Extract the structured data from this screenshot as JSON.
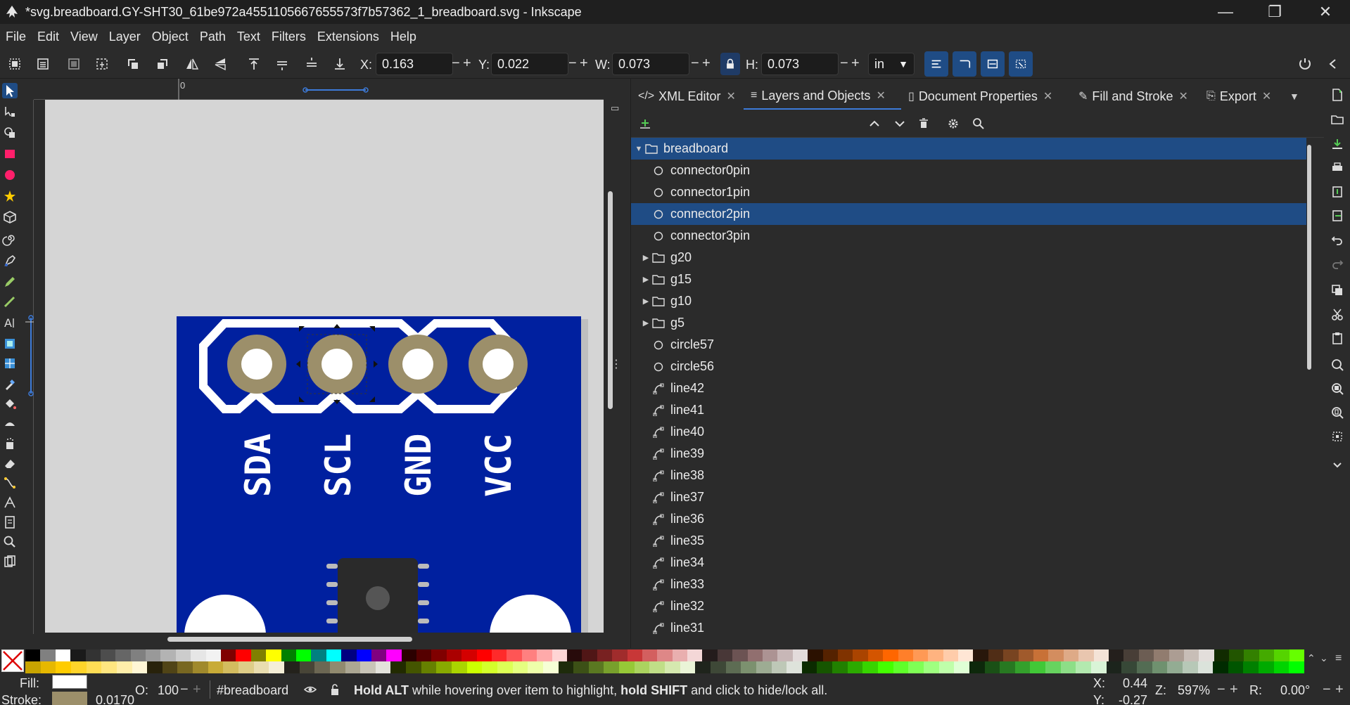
{
  "window": {
    "title": "*svg.breadboard.GY-SHT30_61be972a4551105667655573f7b57362_1_breadboard.svg - Inkscape",
    "minimize": "—",
    "maximize": "❐",
    "close": "✕"
  },
  "menu": [
    "File",
    "Edit",
    "View",
    "Layer",
    "Object",
    "Path",
    "Text",
    "Filters",
    "Extensions",
    "Help"
  ],
  "toolbar": {
    "x_label": "X:",
    "x_value": "0.163",
    "y_label": "Y:",
    "y_value": "0.022",
    "w_label": "W:",
    "w_value": "0.073",
    "h_label": "H:",
    "h_value": "0.073",
    "minus": "−",
    "plus": "+",
    "unit": "in"
  },
  "ruler": {
    "origin_label": "0"
  },
  "board": {
    "pin_labels": [
      "SDA",
      "SCL",
      "GND",
      "VCC"
    ],
    "colors": {
      "board": "#00209f",
      "pad": "#9c8f6a",
      "silk": "#ffffff",
      "chip": "#2a2a2a"
    }
  },
  "dock": {
    "tabs": [
      {
        "label": "XML Editor",
        "icon": "xml-icon"
      },
      {
        "label": "Layers and Objects",
        "icon": "layers-icon"
      },
      {
        "label": "Document Properties",
        "icon": "document-icon"
      },
      {
        "label": "Fill and Stroke",
        "icon": "fill-stroke-icon"
      },
      {
        "label": "Export",
        "icon": "export-icon"
      }
    ],
    "tree": [
      {
        "label": "breadboard",
        "type": "group",
        "depth": 0,
        "expanded": true,
        "selected": true
      },
      {
        "label": "connector0pin",
        "type": "circle",
        "depth": 1
      },
      {
        "label": "connector1pin",
        "type": "circle",
        "depth": 1
      },
      {
        "label": "connector2pin",
        "type": "circle",
        "depth": 1,
        "selected": true
      },
      {
        "label": "connector3pin",
        "type": "circle",
        "depth": 1
      },
      {
        "label": "g20",
        "type": "group",
        "depth": 1,
        "collapsed": true
      },
      {
        "label": "g15",
        "type": "group",
        "depth": 1,
        "collapsed": true
      },
      {
        "label": "g10",
        "type": "group",
        "depth": 1,
        "collapsed": true
      },
      {
        "label": "g5",
        "type": "group",
        "depth": 1,
        "collapsed": true
      },
      {
        "label": "circle57",
        "type": "circle",
        "depth": 1
      },
      {
        "label": "circle56",
        "type": "circle",
        "depth": 1
      },
      {
        "label": "line42",
        "type": "line",
        "depth": 1
      },
      {
        "label": "line41",
        "type": "line",
        "depth": 1
      },
      {
        "label": "line40",
        "type": "line",
        "depth": 1
      },
      {
        "label": "line39",
        "type": "line",
        "depth": 1
      },
      {
        "label": "line38",
        "type": "line",
        "depth": 1
      },
      {
        "label": "line37",
        "type": "line",
        "depth": 1
      },
      {
        "label": "line36",
        "type": "line",
        "depth": 1
      },
      {
        "label": "line35",
        "type": "line",
        "depth": 1
      },
      {
        "label": "line34",
        "type": "line",
        "depth": 1
      },
      {
        "label": "line33",
        "type": "line",
        "depth": 1
      },
      {
        "label": "line32",
        "type": "line",
        "depth": 1
      },
      {
        "label": "line31",
        "type": "line",
        "depth": 1
      }
    ]
  },
  "status": {
    "fill_label": "Fill:",
    "stroke_label": "Stroke:",
    "stroke_width": "0.0170",
    "fill_color": "#ffffff",
    "stroke_color": "#9c8f6a",
    "opacity_label": "O:",
    "opacity_value": "100",
    "layer": "#breadboard",
    "message_bold1": "Hold ALT",
    "message_mid": " while hovering over item to highlight, ",
    "message_bold2": "hold SHIFT",
    "message_end": " and click to hide/lock all.",
    "cursor_x_label": "X:",
    "cursor_x": "0.44",
    "cursor_y_label": "Y:",
    "cursor_y": "-0.27",
    "zoom_label": "Z:",
    "zoom_value": "597%",
    "rotation_label": "R:",
    "rotation_value": "0.00°"
  },
  "palette": {
    "row1": [
      "#000000",
      "#808080",
      "#ffffff",
      "#1a1a1a",
      "#333333",
      "#4d4d4d",
      "#666666",
      "#808080",
      "#999999",
      "#b3b3b3",
      "#cccccc",
      "#e6e6e6",
      "#f2f2f2",
      "#800000",
      "#ff0000",
      "#808000",
      "#ffff00",
      "#008000",
      "#00ff00",
      "#008080",
      "#00ffff",
      "#000080",
      "#0000ff",
      "#800080",
      "#ff00ff",
      "#2b0000",
      "#550000",
      "#800000",
      "#aa0000",
      "#d40000",
      "#ff0000",
      "#ff2a2a",
      "#ff5555",
      "#ff8080",
      "#ffaaaa",
      "#ffd5d5",
      "#280b0b",
      "#501616",
      "#782121",
      "#a02c2c",
      "#c83737",
      "#d35f5f",
      "#de8787",
      "#e9afaf",
      "#f4d7d7",
      "#241c1c",
      "#483737",
      "#6c5353",
      "#916f6f",
      "#ac9393",
      "#c8b7b7",
      "#e3dbdb",
      "#2b1100",
      "#552200",
      "#803300",
      "#aa4400",
      "#d45500",
      "#ff6600",
      "#ff7f2a",
      "#ff9955",
      "#ffb380",
      "#ffccaa",
      "#ffe6d5",
      "#28170b",
      "#502d16",
      "#784421",
      "#a05a2c",
      "#c87137",
      "#d38d5f",
      "#deaa87",
      "#e9c6af",
      "#f4e3d7",
      "#241f1c",
      "#483e37",
      "#6c5d53",
      "#917c6f",
      "#ac9d93",
      "#c8beb7",
      "#e3dedb",
      "#112b00",
      "#225500",
      "#338000",
      "#44aa00",
      "#55d400",
      "#66ff00"
    ],
    "row2": [
      "#c8a400",
      "#e6b800",
      "#ffcc00",
      "#ffd42a",
      "#ffdd55",
      "#ffe680",
      "#ffeeaa",
      "#fff6d5",
      "#28220b",
      "#504416",
      "#786721",
      "#a0892c",
      "#c8ab37",
      "#d3bc5f",
      "#decd87",
      "#e9ddaf",
      "#f4eed7",
      "#24221c",
      "#484537",
      "#6c6753",
      "#918a6f",
      "#aca793",
      "#c8c4b7",
      "#e3e2db",
      "#222b00",
      "#445500",
      "#668000",
      "#88aa00",
      "#aad400",
      "#ccff00",
      "#d4ff2a",
      "#ddff55",
      "#e5ff80",
      "#eeffaa",
      "#f6ffd5",
      "#1e2b0b",
      "#3c5016",
      "#5a7821",
      "#78a02c",
      "#96c837",
      "#abd35f",
      "#c0de87",
      "#d5e9af",
      "#eaf4d7",
      "#1f241c",
      "#3e4837",
      "#5d6c53",
      "#7c916f",
      "#9dac93",
      "#bec8b7",
      "#dee3db",
      "#0b2b00",
      "#165500",
      "#218000",
      "#2caa00",
      "#37d400",
      "#44ff00",
      "#5fff2a",
      "#7fff55",
      "#9fff80",
      "#bfffaa",
      "#dfffd5",
      "#0d280b",
      "#1a5016",
      "#277821",
      "#34a02c",
      "#41c837",
      "#67d35f",
      "#8dde87",
      "#b3e9af",
      "#d9f4d7",
      "#1c241c",
      "#374837",
      "#536c53",
      "#6f916f",
      "#93ac93",
      "#b7c8b7",
      "#dbe3db",
      "#002b00",
      "#005500",
      "#008000",
      "#00aa00",
      "#00d400",
      "#00ff00"
    ]
  }
}
